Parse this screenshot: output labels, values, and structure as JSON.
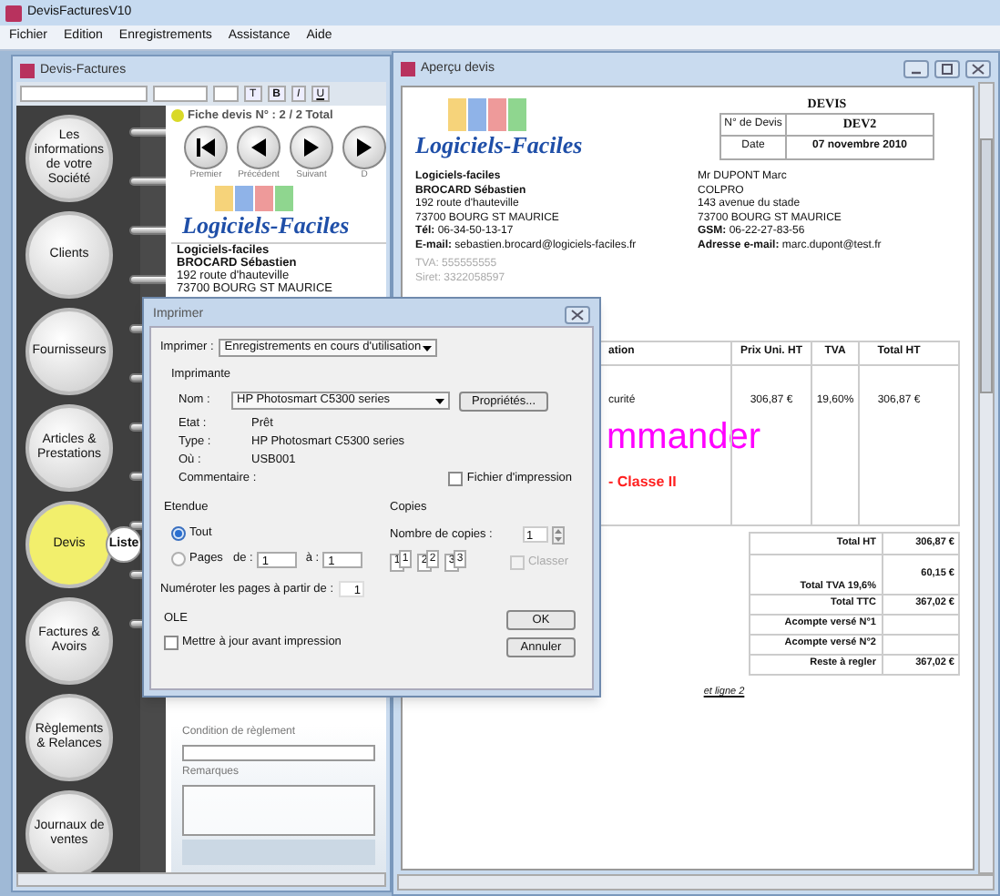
{
  "window": {
    "title": "DevisFacturesV10"
  },
  "menu": [
    "Fichier",
    "Edition",
    "Enregistrements",
    "Assistance",
    "Aide"
  ],
  "form_window": {
    "title": "Devis-Factures",
    "toolbar_buttons": [
      "T",
      "B",
      "I",
      "U"
    ],
    "nav_items": [
      {
        "label": "Les informations de votre Société",
        "selected": false
      },
      {
        "label": "Clients",
        "selected": false
      },
      {
        "label": "Fournisseurs",
        "selected": false
      },
      {
        "label": "Articles & Prestations",
        "selected": false
      },
      {
        "label": "Devis",
        "selected": true
      },
      {
        "label": "Factures & Avoirs",
        "selected": false
      },
      {
        "label": "Règlements & Relances",
        "selected": false
      },
      {
        "label": "Journaux de ventes",
        "selected": false
      }
    ],
    "list_button": "Liste",
    "record_label": "Fiche devis N° : 2 / 2 Total",
    "record_buttons": [
      "Premier",
      "Précédent",
      "Suivant",
      "D"
    ],
    "logo": "Logiciels-Faciles",
    "company_lines": [
      "Logiciels-faciles",
      "BROCARD Sébastien",
      "192 route d'hauteville",
      "73700 BOURG ST MAURICE"
    ],
    "payment_label": "Condition de règlement",
    "remarks_label": "Remarques"
  },
  "preview_window": {
    "title": "Aperçu devis",
    "logo": "Logiciels-Faciles",
    "doc_title": "DEVIS",
    "doc_fields": [
      {
        "label": "N° de Devis",
        "value": "DEV2"
      },
      {
        "label": "Date",
        "value": "07 novembre 2010"
      }
    ],
    "sender_lines": [
      "**Logiciels-faciles**",
      "**BROCARD Sébastien**",
      "192 route d'hauteville",
      "73700 BOURG ST MAURICE",
      "**Tél:** 06-34-50-13-17",
      "**E-mail:** sebastien.brocard@logiciels-faciles.fr"
    ],
    "tax_lines": [
      "TVA: 555555555",
      "Siret: 3322058597"
    ],
    "client_lines": [
      "Mr DUPONT Marc",
      "COLPRO",
      "143 avenue du stade",
      "73700 BOURG ST MAURICE",
      "**GSM:** 06-22-27-83-56",
      "**Adresse e-mail:** marc.dupont@test.fr"
    ],
    "table_columns": [
      "ation",
      "Prix Uni. HT",
      "TVA",
      "Total HT"
    ],
    "table_row": [
      "curité",
      "306,87 €",
      "19,60%",
      "306,87 €"
    ],
    "highlight_text": "mmander",
    "class_text": "- Classe II",
    "totals": [
      {
        "label": "Total HT",
        "value": "306,87 €"
      },
      {
        "label": "Total TVA 19,6%",
        "value": "60,15 €"
      },
      {
        "label": "Total TTC",
        "value": "367,02 €"
      },
      {
        "label": "Acompte versé N°1"
      },
      {
        "label": "Acompte versé N°2"
      },
      {
        "label": "Reste à regler",
        "value": "367,02 €"
      }
    ],
    "note_link": "et ligne 2"
  },
  "print_dialog": {
    "title": "Imprimer",
    "print_label": "Imprimer :",
    "print_value": "Enregistrements en cours d'utilisation",
    "printer_group": "Imprimante",
    "name_label": "Nom :",
    "name_value": "HP Photosmart C5300 series",
    "properties_button": "Propriétés...",
    "info": [
      {
        "label": "Etat :",
        "value": "Prêt"
      },
      {
        "label": "Type :",
        "value": "HP Photosmart C5300 series"
      },
      {
        "label": "Où :",
        "value": "USB001"
      },
      {
        "label": "Commentaire :"
      }
    ],
    "print_to_file": {
      "label": "Fichier d'impression",
      "checked": false
    },
    "range_group": "Etendue",
    "range_options": [
      {
        "label": "Tout",
        "selected": true
      },
      {
        "label": "Pages",
        "selected": false
      }
    ],
    "from_label": "de :",
    "from_value": "1",
    "to_label": "à :",
    "to_value": "1",
    "numbering_label": "Numéroter les pages à partir de :",
    "numbering_value": "1",
    "copies_group": "Copies",
    "copies_label": "Nombre de copies :",
    "copies_value": "1",
    "collate_pages": [
      "1",
      "1",
      "2",
      "2",
      "3",
      "3"
    ],
    "collate": {
      "label": "Classer",
      "checked": false,
      "disabled": true
    },
    "ole_group": "OLE",
    "update_before": {
      "label": "Mettre à jour avant impression",
      "checked": false
    },
    "buttons": [
      "OK",
      "Annuler"
    ]
  }
}
